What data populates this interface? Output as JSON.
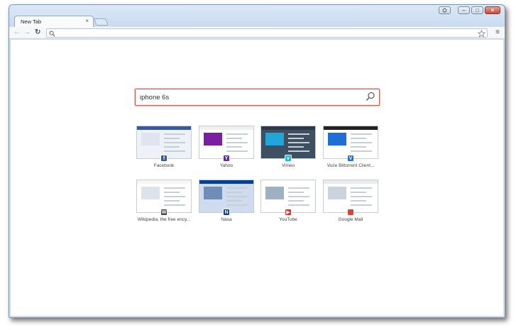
{
  "browser": {
    "tab": {
      "title": "New Tab",
      "close_glyph": "×"
    },
    "new_tab_button": "new-tab-shape",
    "window_controls": {
      "person": "⛭",
      "minimize": "–",
      "maximize": "□",
      "close": "×"
    },
    "nav": {
      "back": "←",
      "forward": "→",
      "reload": "↻"
    },
    "omnibox": {
      "value": "",
      "placeholder": ""
    },
    "menu_glyph": "≡"
  },
  "search": {
    "value": "iphone 6s",
    "icon": "search-icon",
    "focus_color": "#e05a4e"
  },
  "most_visited": [
    {
      "label": "Facebook",
      "favicon": "f",
      "color": "#3b5998"
    },
    {
      "label": "Yahoo",
      "favicon": "Y",
      "color": "#5f2fa0"
    },
    {
      "label": "Vimeo",
      "favicon": "v",
      "color": "#1ab7ea"
    },
    {
      "label": "Vuze Bittorrent Client...",
      "favicon": "V",
      "color": "#1e6ed8"
    },
    {
      "label": "Wikipedia, the free ency...",
      "favicon": "W",
      "color": "#444444"
    },
    {
      "label": "Nasa",
      "favicon": "N",
      "color": "#0b3d91"
    },
    {
      "label": "YouTube",
      "favicon": "▶",
      "color": "#e52d27"
    },
    {
      "label": "Google Mail",
      "favicon": "",
      "color": "#d44638"
    }
  ]
}
